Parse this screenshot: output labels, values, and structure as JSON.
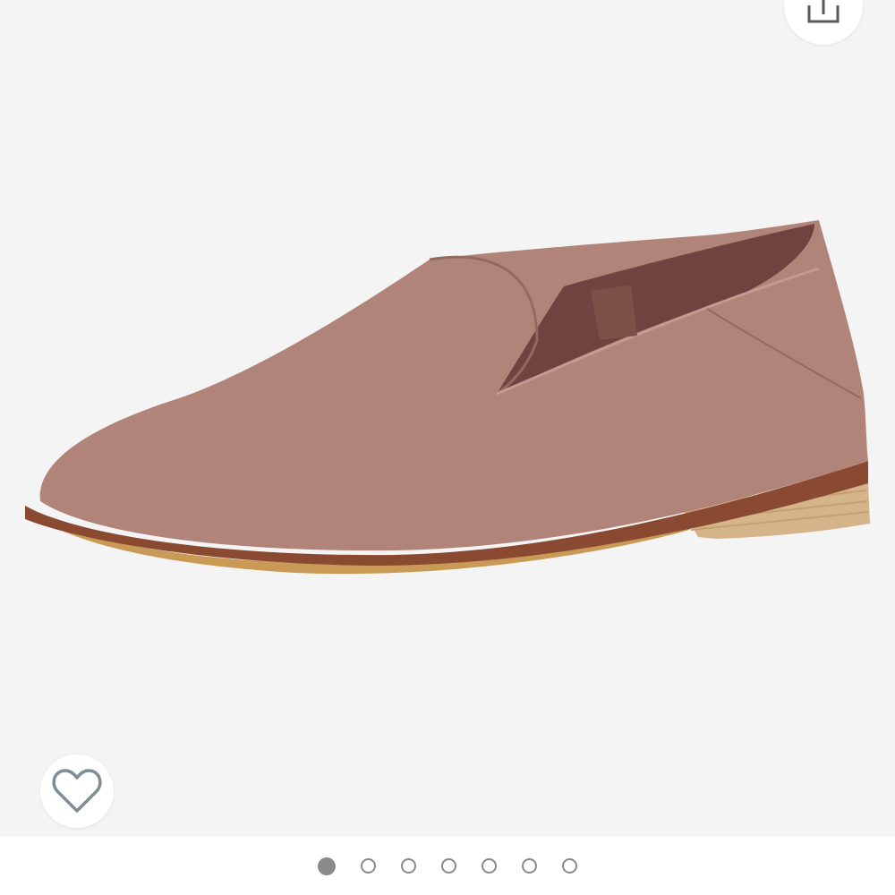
{
  "product_gallery": {
    "image_subject": "loafer-shoe",
    "colors": {
      "background": "#f4f4f4",
      "upper": "#b08479",
      "lining": "#6e4340",
      "welt": "#8a4a32",
      "sole": "#c99a55",
      "heel": "#d6b48a"
    }
  },
  "share": {
    "icon": "share-icon"
  },
  "wishlist": {
    "icon": "heart-icon"
  },
  "pager": {
    "total": 7,
    "active_index": 0,
    "active_color": "#8a8a8a"
  }
}
